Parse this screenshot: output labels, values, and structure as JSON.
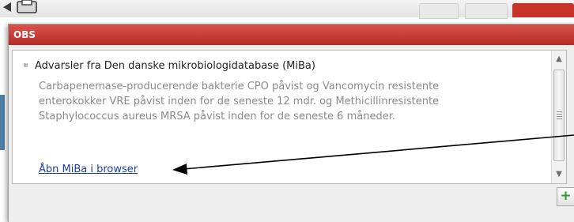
{
  "dialog": {
    "title": "OBS",
    "alert": {
      "heading": "Advarsler fra Den danske mikrobiologidatabase (MiBa)",
      "body": "Carbapenemase-producerende bakterie CPO påvist og Vancomycin resistente enterokokker VRE påvist inden for de seneste 12 mdr. og Methicillinresistente Staphylococcus aureus MRSA påvist inden for de seneste 6 måneder.",
      "link_label": "Åbn MiBa i browser"
    },
    "add_label": "+"
  },
  "icons": {
    "printer": "printer-icon",
    "scroll_up": "arrow-up-icon",
    "scroll_down": "arrow-down-icon",
    "add": "plus-icon"
  },
  "colors": {
    "titlebar": "#c73328",
    "link": "#1a3fa8",
    "body_text": "#8a8a8a",
    "add_icon": "#2b9a2b"
  }
}
